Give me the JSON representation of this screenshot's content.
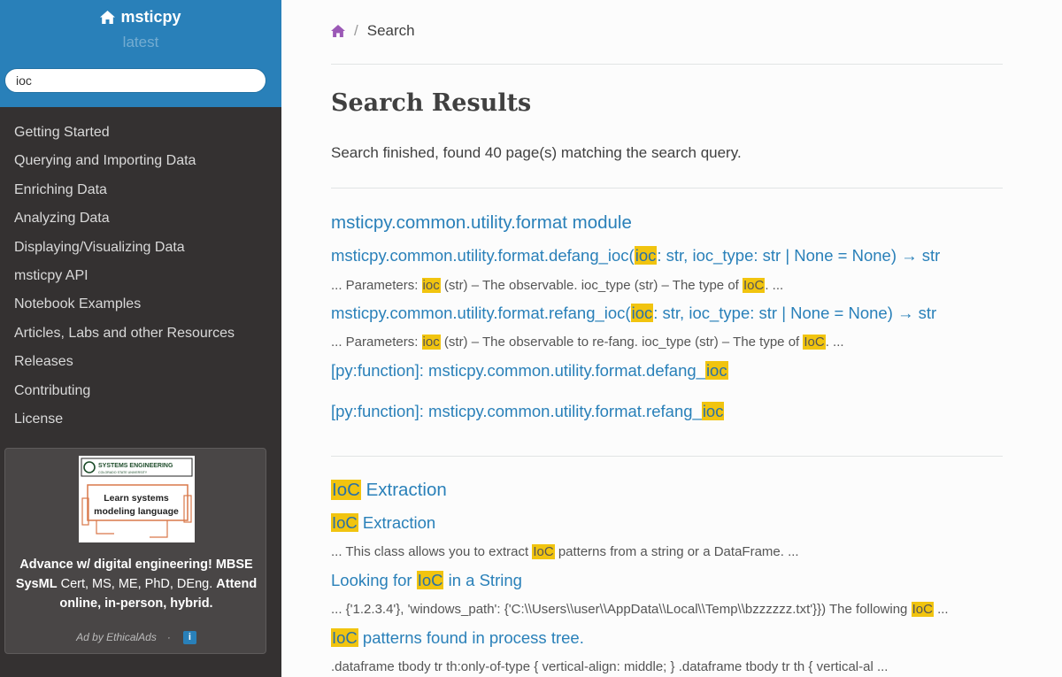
{
  "sidebar": {
    "project": "msticpy",
    "version": "latest",
    "search_value": "ioc",
    "nav": [
      "Getting Started",
      "Querying and Importing Data",
      "Enriching Data",
      "Analyzing Data",
      "Displaying/Visualizing Data",
      "msticpy API",
      "Notebook Examples",
      "Articles, Labs and other Resources",
      "Releases",
      "Contributing",
      "License"
    ],
    "ad": {
      "logo_text": "SYSTEMS ENGINEERING",
      "logo_subtext": "COLORADO STATE UNIVERSITY",
      "image_text": "Learn systems modeling language",
      "text_bold1": "Advance w/ digital engineering!",
      "text_bold2": "MBSE SysML",
      "text_plain1": "Cert, MS, ME, PhD, DEng.",
      "text_bold3": "Attend online, in-person, hybrid.",
      "by": "Ad by EthicalAds",
      "dot": "·",
      "info": "i"
    }
  },
  "breadcrumb": {
    "home_icon": "home-icon",
    "sep": "/",
    "current": "Search"
  },
  "page": {
    "title": "Search Results",
    "summary": "Search finished, found 40 page(s) matching the search query."
  },
  "results": {
    "r1_title": "msticpy.common.utility.format module",
    "r1_a": {
      "pre": "msticpy.common.utility.format.defang_ioc(",
      "hl": "ioc",
      "post": ": str, ioc_type: str | None = None) → str"
    },
    "r1_a_ctx": {
      "pre": "... Parameters: ",
      "hl1": "ioc",
      "mid": " (str) – The observable. ioc_type (str) – The type of ",
      "hl2": "IoC",
      "post": ". ..."
    },
    "r1_b": {
      "pre": "msticpy.common.utility.format.refang_ioc(",
      "hl": "ioc",
      "post": ": str, ioc_type: str | None = None) → str"
    },
    "r1_b_ctx": {
      "pre": "... Parameters: ",
      "hl1": "ioc",
      "mid": " (str) – The observable to re-fang. ioc_type (str) – The type of ",
      "hl2": "IoC",
      "post": ". ..."
    },
    "r1_c": {
      "pre": "[py:function]: msticpy.common.utility.format.defang_",
      "hl": "ioc"
    },
    "r1_d": {
      "pre": "[py:function]: msticpy.common.utility.format.refang_",
      "hl": "ioc"
    },
    "r2_title": {
      "hl": "IoC",
      "post": " Extraction"
    },
    "r2_a": {
      "hl": "IoC",
      "post": " Extraction"
    },
    "r2_a_ctx": {
      "pre": "... This class allows you to extract ",
      "hl": "IoC",
      "post": " patterns from a string or a DataFrame. ..."
    },
    "r2_b": {
      "pre": "Looking for ",
      "hl": "IoC",
      "post": " in a String"
    },
    "r2_b_ctx": {
      "pre": "... {'1.2.3.4'}, 'windows_path': {'C:\\\\Users\\\\user\\\\AppData\\\\Local\\\\Temp\\\\bzzzzzz.txt'}}) The following ",
      "hl": "IoC",
      "post": " ..."
    },
    "r2_c": {
      "hl": "IoC",
      "post": " patterns found in process tree."
    },
    "r2_c_ctx": ".dataframe tbody tr th:only-of-type { vertical-align: middle; } .dataframe tbody tr th { vertical-al ..."
  }
}
